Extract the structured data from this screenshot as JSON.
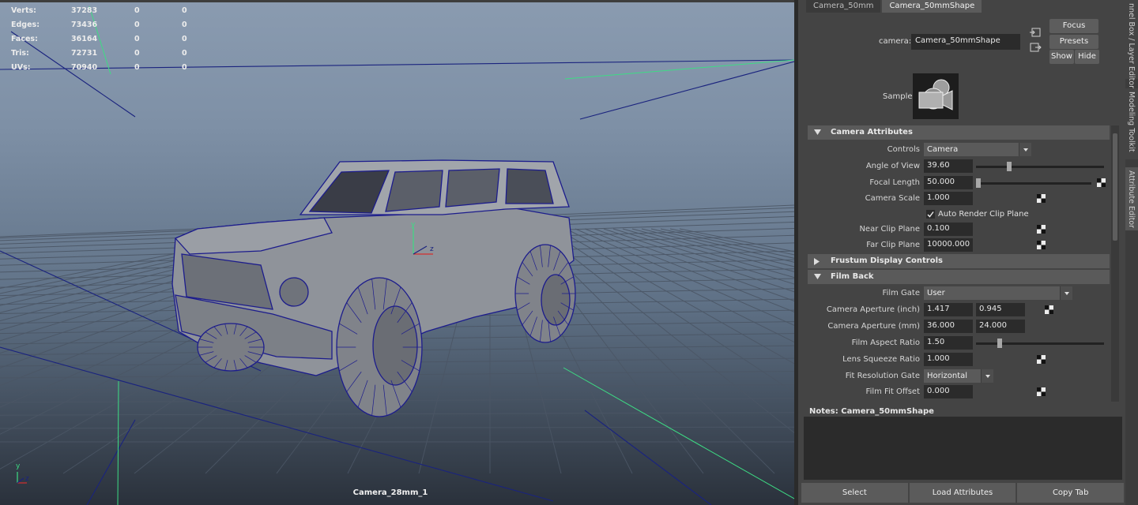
{
  "viewport": {
    "hud": [
      {
        "label": "Verts:",
        "value": "37283",
        "a": "0",
        "b": "0"
      },
      {
        "label": "Edges:",
        "value": "73436",
        "a": "0",
        "b": "0"
      },
      {
        "label": "Faces:",
        "value": "36164",
        "a": "0",
        "b": "0"
      },
      {
        "label": "Tris:",
        "value": "72731",
        "a": "0",
        "b": "0"
      },
      {
        "label": "UVs:",
        "value": "70940",
        "a": "0",
        "b": "0"
      }
    ],
    "camera_name": "Camera_28mm_1",
    "gizmo_y": "y",
    "gizmo_z": "z",
    "pivot_y": "y",
    "pivot_z": "z"
  },
  "attribute_editor": {
    "tabs": [
      "Camera_50mm",
      "Camera_50mmShape"
    ],
    "camera_label": "camera:",
    "camera_value": "Camera_50mmShape",
    "buttons": {
      "focus": "Focus",
      "presets": "Presets",
      "show": "Show",
      "hide": "Hide"
    },
    "sample_label": "Sample",
    "sections": {
      "camera_attributes": "Camera Attributes",
      "frustum": "Frustum Display Controls",
      "film_back": "Film Back"
    },
    "fields": {
      "controls_label": "Controls",
      "controls_value": "Camera",
      "aov_label": "Angle of View",
      "aov_value": "39.60",
      "focal_label": "Focal Length",
      "focal_value": "50.000",
      "scale_label": "Camera Scale",
      "scale_value": "1.000",
      "auto_clip_label": "Auto Render Clip Plane",
      "near_label": "Near Clip Plane",
      "near_value": "0.100",
      "far_label": "Far Clip Plane",
      "far_value": "10000.000",
      "film_gate_label": "Film Gate",
      "film_gate_value": "User",
      "ap_inch_label": "Camera Aperture (inch)",
      "ap_inch_w": "1.417",
      "ap_inch_h": "0.945",
      "ap_mm_label": "Camera Aperture (mm)",
      "ap_mm_w": "36.000",
      "ap_mm_h": "24.000",
      "aspect_label": "Film Aspect Ratio",
      "aspect_value": "1.50",
      "squeeze_label": "Lens Squeeze Ratio",
      "squeeze_value": "1.000",
      "fit_gate_label": "Fit Resolution Gate",
      "fit_gate_value": "Horizontal",
      "fit_offset_label": "Film Fit Offset",
      "fit_offset_value": "0.000"
    },
    "slider_levels": {
      "angle_of_view": 0.25,
      "focal_length": 0.0,
      "film_aspect_ratio": 0.17
    },
    "auto_render_clip_checked": true,
    "notes_label": "Notes:  Camera_50mmShape",
    "bottom_buttons": [
      "Select",
      "Load Attributes",
      "Copy Tab"
    ]
  },
  "side_tabs": [
    "nnel Box / Layer Editor",
    "Modeling Toolkit",
    "Attribute Editor"
  ]
}
